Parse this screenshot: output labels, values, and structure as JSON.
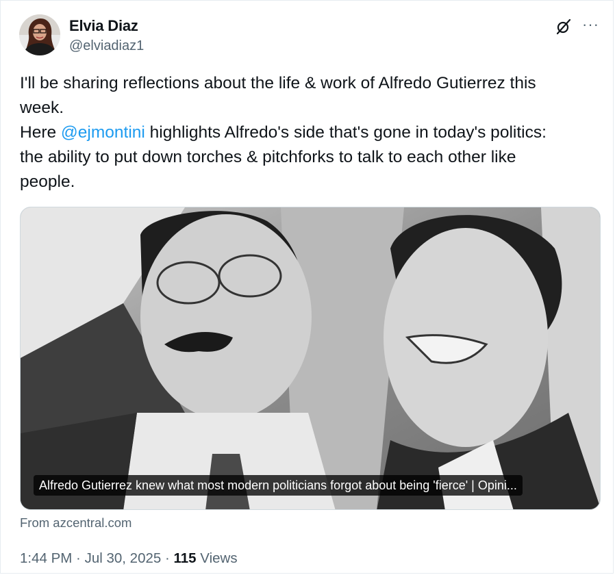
{
  "tweet": {
    "author_name": "Elvia Diaz",
    "author_handle": "@elviadiaz1",
    "text_line1": "I'll be sharing reflections about the life & work of Alfredo Gutierrez this",
    "text_line2": "week.",
    "text_line3_prefix": "Here ",
    "mention": "@ejmontini",
    "text_line3_suffix": " highlights Alfredo's side that's gone in today's politics:",
    "text_line4": "the ability to put down torches &  pitchforks to talk to each other like",
    "text_line5": "people.",
    "card_title": "Alfredo Gutierrez knew what most modern politicians forgot about being 'fierce' | Opini...",
    "card_source": "From azcentral.com",
    "time": "1:44 PM",
    "separator": " · ",
    "date": "Jul 30, 2025",
    "views_count": "115",
    "views_label": " Views",
    "more_label": "···"
  },
  "colors": {
    "link": "#1d9bf0",
    "text_primary": "#0f1419",
    "text_secondary": "#536471",
    "border": "#cfd9de"
  },
  "icons": {
    "logo": "x-logo-icon",
    "more": "more-horizontal-icon"
  }
}
